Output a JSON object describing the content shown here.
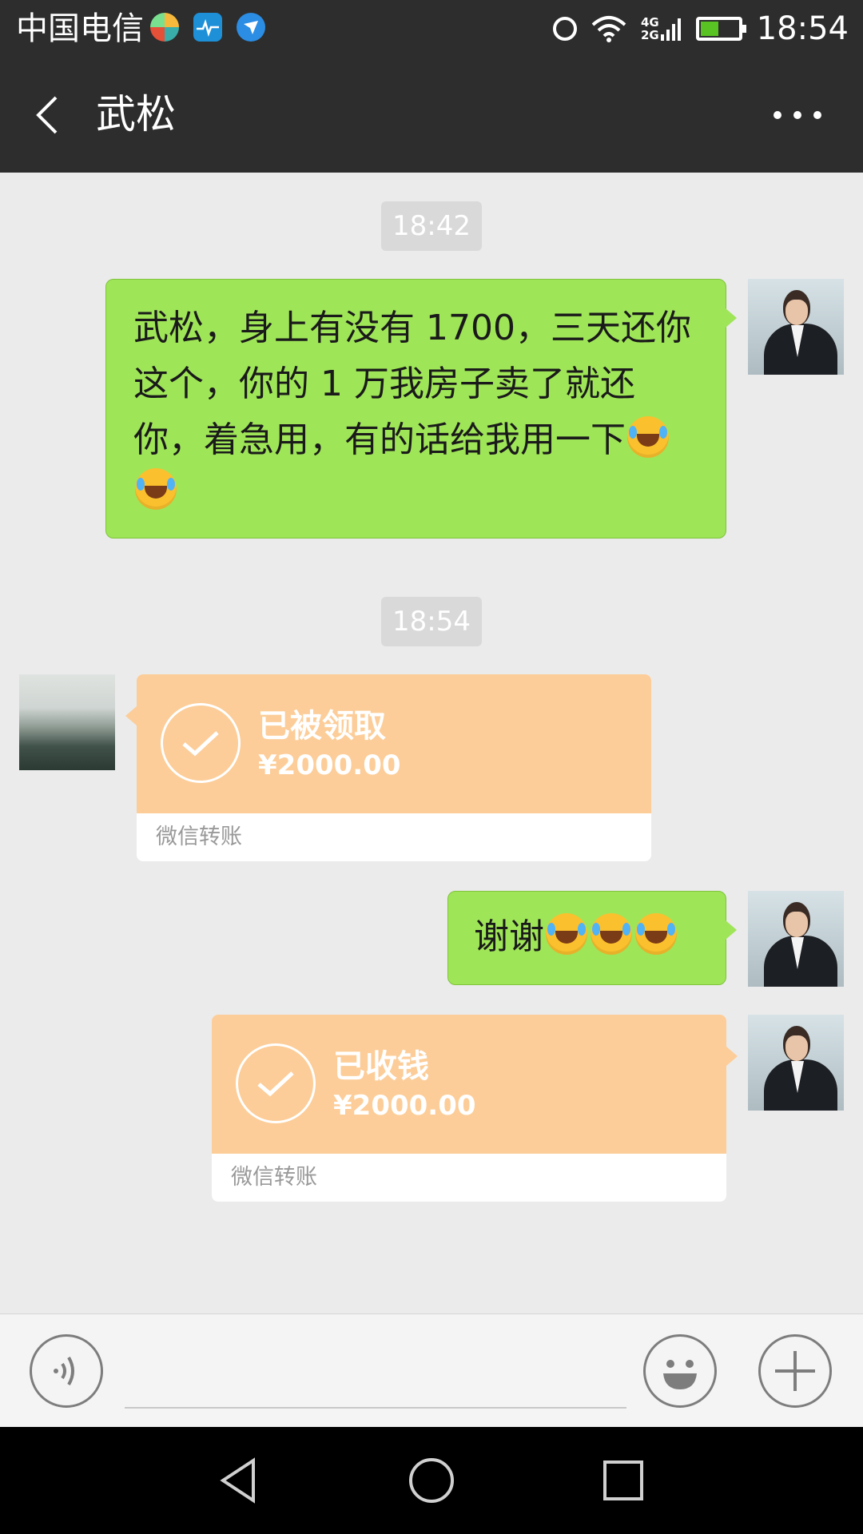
{
  "status_bar": {
    "carrier": "中国电信",
    "network_upper": "4G",
    "network_lower": "2G",
    "time": "18:54",
    "icons": [
      "app-icon-1",
      "app-icon-2",
      "app-icon-3",
      "alarm-icon",
      "wifi-icon",
      "signal-icon",
      "battery-charging-icon"
    ]
  },
  "header": {
    "title": "武松",
    "back_icon": "chevron-left-icon",
    "more_icon": "more-dots-icon"
  },
  "messages": [
    {
      "type": "timestamp",
      "text": "18:42"
    },
    {
      "type": "text",
      "side": "right",
      "text": "武松，身上有没有 1700，三天还你这个，你的 1 万我房子卖了就还你，着急用，有的话给我用一下",
      "emoji_count": 2,
      "emoji": "rolling-on-floor-laughing"
    },
    {
      "type": "timestamp",
      "text": "18:54"
    },
    {
      "type": "transfer",
      "side": "left",
      "status": "已被领取",
      "amount": "¥2000.00",
      "footer": "微信转账"
    },
    {
      "type": "text",
      "side": "right",
      "text": "谢谢",
      "emoji_count": 3,
      "emoji": "rolling-on-floor-laughing"
    },
    {
      "type": "transfer",
      "side": "right",
      "status": "已收钱",
      "amount": "¥2000.00",
      "footer": "微信转账"
    }
  ],
  "input_bar": {
    "value": "",
    "icons": [
      "voice-icon",
      "emoji-icon",
      "plus-icon"
    ]
  },
  "nav_bar": {
    "icons": [
      "back-triangle-icon",
      "home-circle-icon",
      "recents-square-icon"
    ]
  },
  "colors": {
    "bar": "#2d2d2d",
    "chat_bg": "#ebebeb",
    "sent_bubble": "#9fe558",
    "transfer": "#fccd98"
  }
}
